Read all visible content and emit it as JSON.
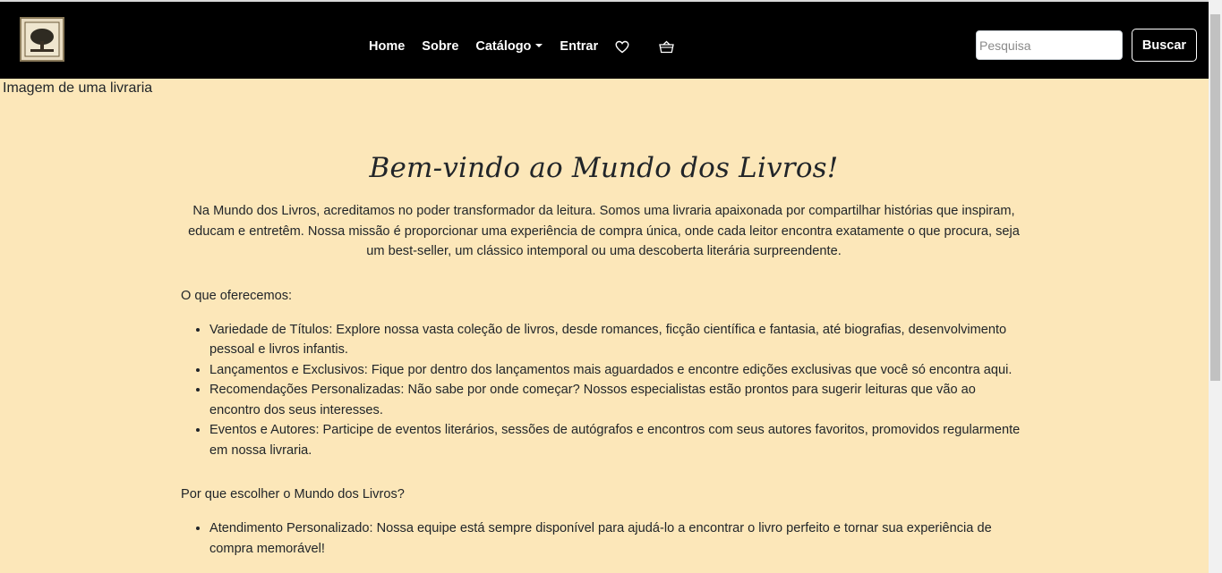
{
  "navbar": {
    "logo_icon": "bookstore-logo",
    "links": [
      "Home",
      "Sobre",
      "Catálogo",
      "Entrar"
    ],
    "icons": [
      "heart-icon",
      "basket-icon"
    ],
    "search": {
      "placeholder": "Pesquisa",
      "value": ""
    },
    "search_button": "Buscar"
  },
  "hero_image_alt": "Imagem de uma livraria",
  "main": {
    "title": "Bem-vindo ao Mundo dos Livros!",
    "intro": "Na Mundo dos Livros, acreditamos no poder transformador da leitura. Somos uma livraria apaixonada por compartilhar histórias que inspiram, educam e entretêm. Nossa missão é proporcionar uma experiência de compra única, onde cada leitor encontra exatamente o que procura, seja um best-seller, um clássico intemporal ou uma descoberta literária surpreendente.",
    "offer_title": "O que oferecemos:",
    "offers": [
      "Variedade de Títulos: Explore nossa vasta coleção de livros, desde romances, ficção científica e fantasia, até biografias, desenvolvimento pessoal e livros infantis.",
      "Lançamentos e Exclusivos: Fique por dentro dos lançamentos mais aguardados e encontre edições exclusivas que você só encontra aqui.",
      "Recomendações Personalizadas: Não sabe por onde começar? Nossos especialistas estão prontos para sugerir leituras que vão ao encontro dos seus interesses.",
      "Eventos e Autores: Participe de eventos literários, sessões de autógrafos e encontros com seus autores favoritos, promovidos regularmente em nossa livraria."
    ],
    "why_title": "Por que escolher o Mundo dos Livros?",
    "why": [
      "Atendimento Personalizado: Nossa equipe está sempre disponível para ajudá-lo a encontrar o livro perfeito e tornar sua experiência de compra memorável!"
    ]
  },
  "colors": {
    "page_background": "#fce7b9",
    "navbar_background": "#000000",
    "text": "#212529"
  }
}
